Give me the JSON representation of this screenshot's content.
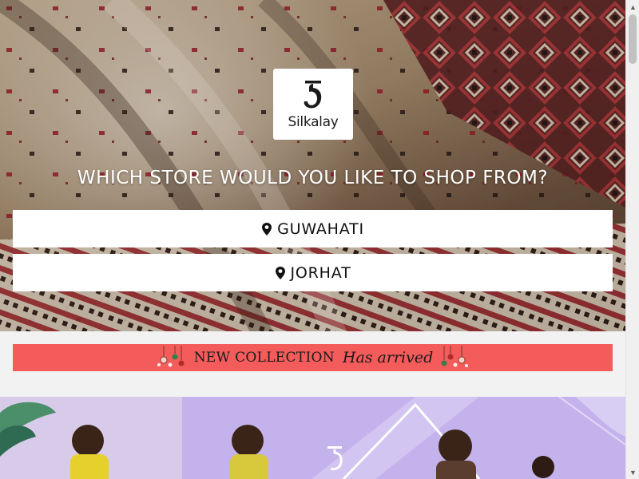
{
  "brand": {
    "name": "Silkalay"
  },
  "hero": {
    "title": "WHICH STORE WOULD YOU LIKE TO SHOP FROM?",
    "stores": [
      {
        "label": "GUWAHATI",
        "icon": "map-pin-icon"
      },
      {
        "label": "JORHAT",
        "icon": "map-pin-icon"
      }
    ]
  },
  "banner": {
    "text": "NEW COLLECTION",
    "script": "Has arrived",
    "color": "#f45b5b",
    "icons": [
      "hanging-ornament-icon",
      "hanging-ornament-icon"
    ]
  },
  "colors": {
    "page_bg": "#f2f2f2",
    "button_bg": "#ffffff",
    "promo_bg": "#c9b8ea"
  }
}
